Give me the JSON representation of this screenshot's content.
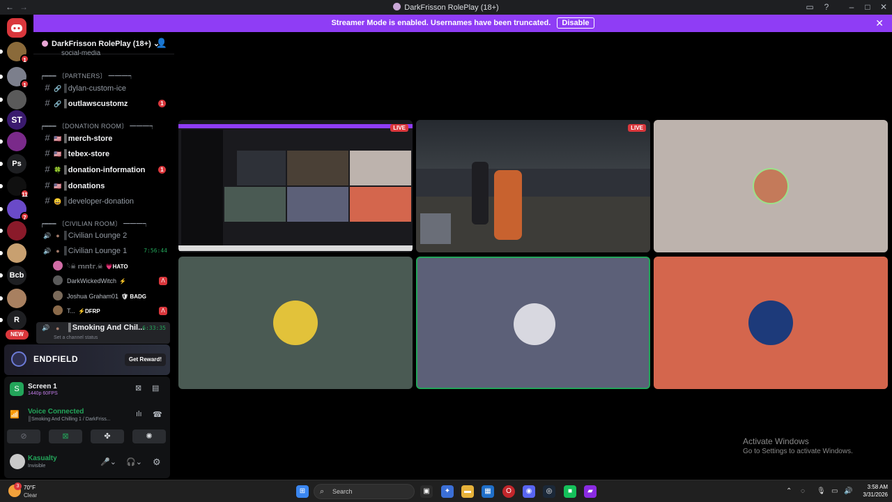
{
  "window": {
    "title": "DarkFrisson RolePlay (18+)",
    "nav_back": "←",
    "nav_forward": "→"
  },
  "banner": {
    "text": "Streamer Mode is enabled. Usernames have been truncated.",
    "button": "Disable"
  },
  "guilds": {
    "items": [
      {
        "label": "",
        "badge": "1",
        "color": "#8a6a3a"
      },
      {
        "label": "",
        "badge": "1",
        "color": "#7c7f8c"
      },
      {
        "label": "",
        "badge": "",
        "color": "#5a5a5a"
      },
      {
        "label": "ST",
        "badge": "",
        "color": "#3a1a6e"
      },
      {
        "label": "",
        "badge": "",
        "color": "#7a2a8a"
      },
      {
        "label": "Ps",
        "badge": "",
        "color": "#1e1f22"
      },
      {
        "label": "",
        "badge": "11",
        "color": "#101010"
      },
      {
        "label": "",
        "badge": "7",
        "color": "#6a4ac8"
      },
      {
        "label": "",
        "badge": "",
        "color": "#8a1a2a"
      },
      {
        "label": "",
        "badge": "",
        "color": "#c8a070"
      },
      {
        "label": "Bcb",
        "badge": "",
        "color": "#1e1f22"
      },
      {
        "label": "",
        "badge": "",
        "color": "#a88060"
      },
      {
        "label": "R",
        "badge": "",
        "color": "#1e1f22"
      }
    ],
    "new_label": "NEW"
  },
  "server": {
    "name": "DarkFrisson RolePlay (18+)",
    "partial_channel": "social-media",
    "categories": {
      "partners": "┍━━━ 〔PARTNERS〕 ━━━┑",
      "donation": "┍━━━ 〔DONATION ROOM〕 ━━━┑",
      "civilian": "┍━━━ 〔CIVILIAN ROOM〕 ━━━┑"
    },
    "channels": [
      {
        "name": "║dylan-custom-ice",
        "emoji": "🔗",
        "unread": false,
        "badge": ""
      },
      {
        "name": "║outlawscustomz",
        "emoji": "🔗",
        "unread": true,
        "badge": "1"
      },
      {
        "name": "║merch-store",
        "emoji": "🇺🇸",
        "unread": true,
        "badge": ""
      },
      {
        "name": "║tebex-store",
        "emoji": "🇺🇸",
        "unread": true,
        "badge": ""
      },
      {
        "name": "║donation-information",
        "emoji": "🍀",
        "unread": true,
        "badge": "1"
      },
      {
        "name": "║donations",
        "emoji": "🇺🇸",
        "unread": true,
        "badge": ""
      },
      {
        "name": "║developer-donation",
        "emoji": "😀",
        "unread": false,
        "badge": ""
      }
    ],
    "voice": [
      {
        "name": "║Civilian Lounge 2",
        "time": ""
      },
      {
        "name": "║Civilian Lounge 1",
        "time": "7:56:44"
      }
    ],
    "voice_users": [
      {
        "name": "𓆩☠︎ 𝕞𝕟𝕥𝕣.☠︎",
        "tag": "💗HATO",
        "color": "#d16ca6",
        "live": false
      },
      {
        "name": "DarkWickedWitch",
        "tag": "⚡",
        "color": "#5a5a5a",
        "live": true
      },
      {
        "name": "Joshua Graham01",
        "tag": "🛡 BADG",
        "color": "#7a6a5a",
        "live": false
      },
      {
        "name": "T...",
        "tag": "⚡DFRP",
        "color": "#8a6a4a",
        "live": true
      }
    ],
    "active_channel": {
      "name": "║Smoking And Chil...",
      "time": "6:33:35",
      "status_placeholder": "Set a channel status"
    }
  },
  "promo": {
    "name": "ENDFIELD",
    "button": "Get Reward!"
  },
  "stream": {
    "title": "Screen 1",
    "quality": "1440p 60FPS"
  },
  "voice_status": {
    "title": "Voice Connected",
    "subtitle": "║Smoking And Chilling 1 / DarkFriss..."
  },
  "user": {
    "name": "Kasualty",
    "status": "Invisible"
  },
  "tiles": {
    "live_label": "LIVE",
    "count": 6,
    "colors": [
      "#1a1a1e",
      "#2e3138",
      "#bdb3ad",
      "#4a5a53",
      "#5c6078",
      "#d4664d"
    ]
  },
  "watermark": {
    "title": "Activate Windows",
    "subtitle": "Go to Settings to activate Windows."
  },
  "taskbar": {
    "weather_temp": "70°F",
    "weather_desc": "Clear",
    "weather_badge": "3",
    "search_placeholder": "Search",
    "time": "3:58 AM",
    "date": "3/31/2026"
  }
}
